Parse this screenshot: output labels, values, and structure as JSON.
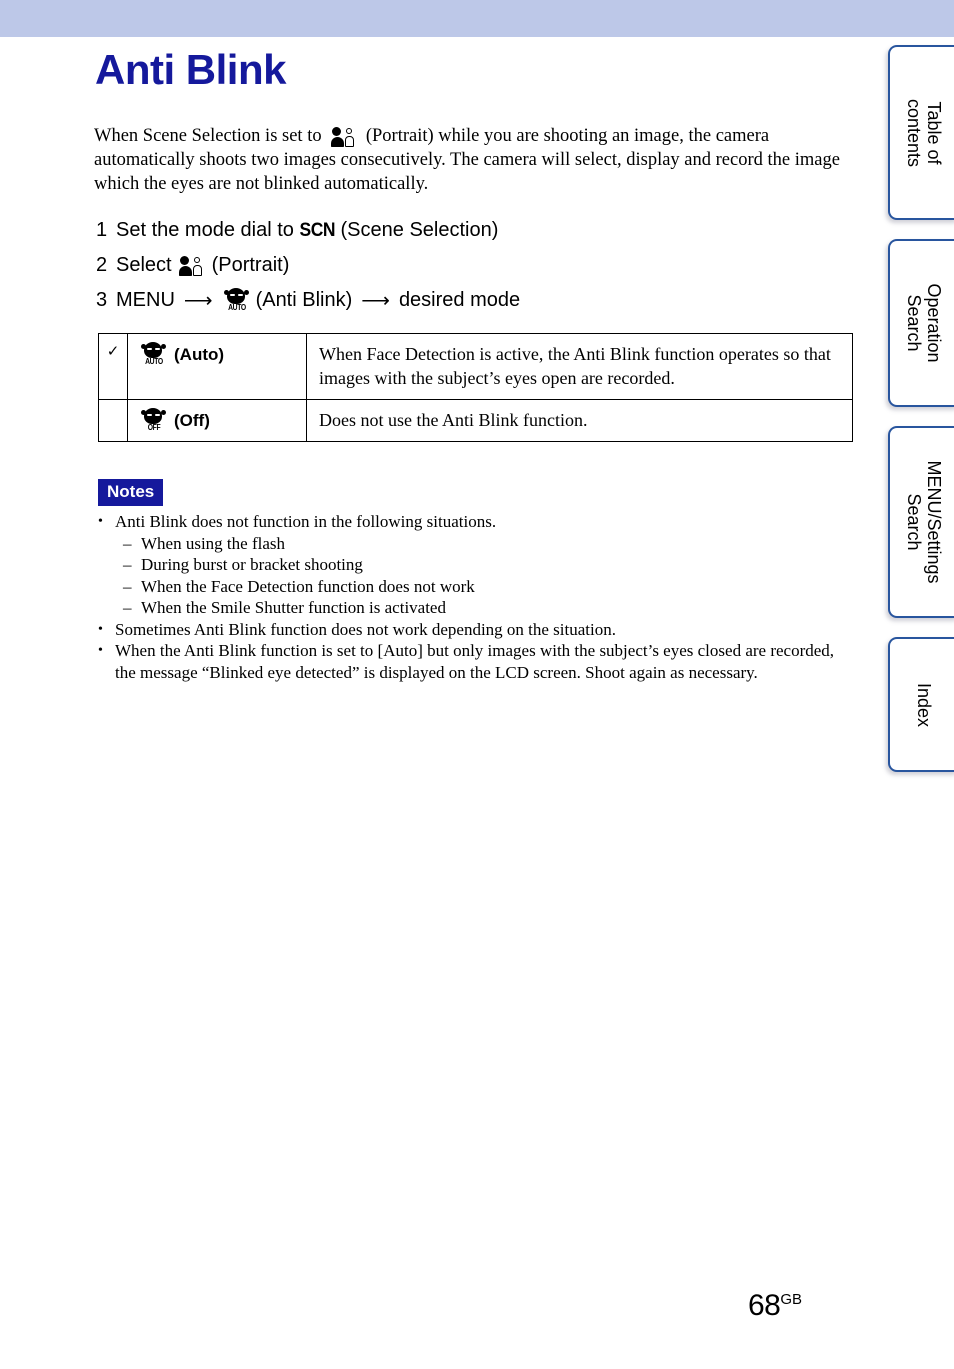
{
  "header": {
    "band_color": "#bdc8e8"
  },
  "page": {
    "title": "Anti Blink",
    "title_color": "#15199c",
    "number": "68",
    "number_suffix": "GB"
  },
  "intro": "When Scene Selection is set to   (Portrait) while you are shooting an image, the camera automatically shoots two images consecutively. The camera will select, display and record the image which the eyes are not blinked automatically.",
  "intro_parts": {
    "before_icon": "When Scene Selection is set to",
    "after_icon": "(Portrait) while you are shooting an image, the camera automatically shoots two images consecutively. The camera will select, display and record the image which the eyes are not blinked automatically."
  },
  "steps": [
    {
      "num": "1",
      "before_icon": "Set the mode dial to",
      "icon": "scn-icon",
      "icon_text": "SCN",
      "after_icon": "(Scene Selection)"
    },
    {
      "num": "2",
      "before_icon": "Select",
      "icon": "portrait-icon",
      "after_icon": "(Portrait)"
    },
    {
      "num": "3",
      "before_icon": "MENU",
      "arrow1": "⟶",
      "icon": "anti-blink-auto-icon",
      "icon_caption": "AUTO",
      "middle": "(Anti Blink)",
      "arrow2": "⟶",
      "after_icon": "desired mode"
    }
  ],
  "settings_table": {
    "rows": [
      {
        "checked": "✓",
        "icon": "anti-blink-auto-icon",
        "icon_caption": "AUTO",
        "option": "(Auto)",
        "description": "When Face Detection is active, the Anti Blink function operates so that images with the subject’s eyes open are recorded."
      },
      {
        "checked": "",
        "icon": "anti-blink-off-icon",
        "icon_caption": "OFF",
        "option": "(Off)",
        "description": "Does not use the Anti Blink function."
      }
    ]
  },
  "notes": {
    "badge": "Notes",
    "badge_bg": "#15199c",
    "items": [
      {
        "bullet": "•",
        "text": "Anti Blink does not function in the following situations.",
        "sub_items": [
          "When using the flash",
          "During burst or bracket shooting",
          "When the Face Detection function does not work",
          "When the Smile Shutter function is activated"
        ]
      },
      {
        "bullet": "•",
        "text": "Sometimes Anti Blink function does not work depending on the situation.",
        "sub_items": []
      },
      {
        "bullet": "•",
        "text": "When the Anti Blink function is set to [Auto] but only images with the subject’s eyes closed are recorded, the message “Blinked eye detected” is displayed on the LCD screen. Shoot again as necessary.",
        "sub_items": []
      }
    ],
    "sub_dash": "–"
  },
  "side_tabs": [
    {
      "label": "Table of\ncontents",
      "line1": "Table of",
      "line2": "contents"
    },
    {
      "label": "Operation\nSearch",
      "line1": "Operation",
      "line2": "Search"
    },
    {
      "label": "MENU/Settings\nSearch",
      "line1": "MENU/Settings",
      "line2": "Search"
    },
    {
      "label": "Index",
      "line1": "Index",
      "line2": ""
    }
  ],
  "colors": {
    "tab_border": "#28559e",
    "accent_navy": "#15199c"
  }
}
